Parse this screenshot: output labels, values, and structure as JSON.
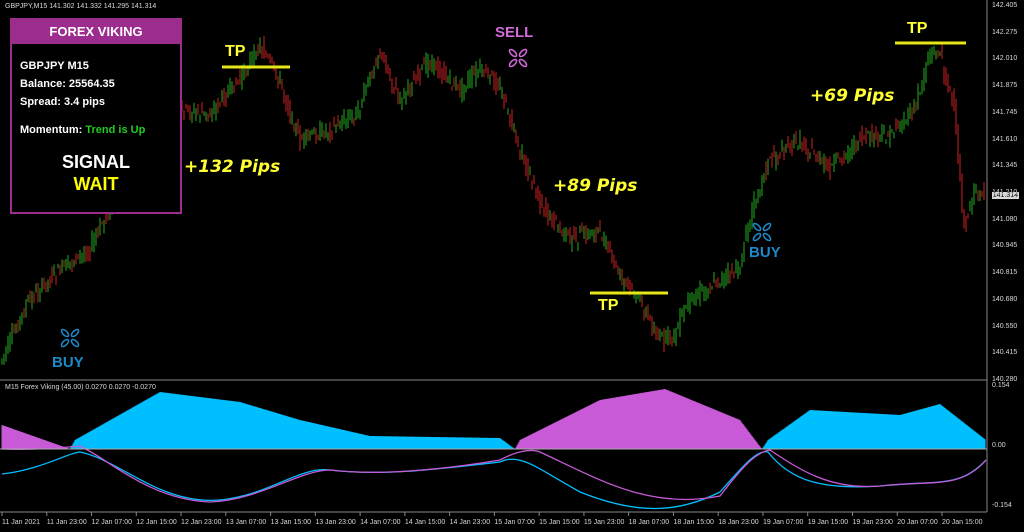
{
  "chart": {
    "symbol_line": "GBPJPY,M15  141.302 141.332 141.295 141.314",
    "indicator_line": "M15 Forex Viking (45.00) 0.0270 0.0270 -0.0270",
    "current_price": "141.314",
    "price_ticks": [
      "142.405",
      "142.275",
      "142.010",
      "141.875",
      "141.745",
      "141.610",
      "141.345",
      "141.210",
      "141.080",
      "140.945",
      "140.815",
      "140.680",
      "140.550",
      "140.415",
      "140.280"
    ],
    "indicator_ticks": [
      "0.154",
      "0.00",
      "-0.154"
    ],
    "date_ticks": [
      "11 Jan 2021",
      "11 Jan 23:00",
      "12 Jan 07:00",
      "12 Jan 15:00",
      "12 Jan 23:00",
      "13 Jan 07:00",
      "13 Jan 15:00",
      "13 Jan 23:00",
      "14 Jan 07:00",
      "14 Jan 15:00",
      "14 Jan 23:00",
      "15 Jan 07:00",
      "15 Jan 15:00",
      "15 Jan 23:00",
      "18 Jan 07:00",
      "18 Jan 15:00",
      "18 Jan 23:00",
      "19 Jan 07:00",
      "19 Jan 15:00",
      "19 Jan 23:00",
      "20 Jan 07:00",
      "20 Jan 15:00"
    ]
  },
  "panel": {
    "title": "FOREX VIKING",
    "pair": "GBPJPY M15",
    "balance": "Balance: 25564.35",
    "spread": "Spread: 3.4 pips",
    "momentum_label": "Momentum:",
    "momentum_value": "Trend is Up",
    "signal_label": "SIGNAL",
    "signal_value": "WAIT"
  },
  "annotations": {
    "tp_label": "TP",
    "buy_label": "BUY",
    "sell_label": "SELL",
    "pips_1": "+132 Pips",
    "pips_2": "+89 Pips",
    "pips_3": "+69 Pips"
  },
  "colors": {
    "bull": "#22aa22",
    "bear": "#cc2222",
    "histogram_up": "#00bfff",
    "histogram_down": "#c85ad8",
    "tp_line": "#e6e619",
    "panel_border": "#9c2c8d"
  }
}
